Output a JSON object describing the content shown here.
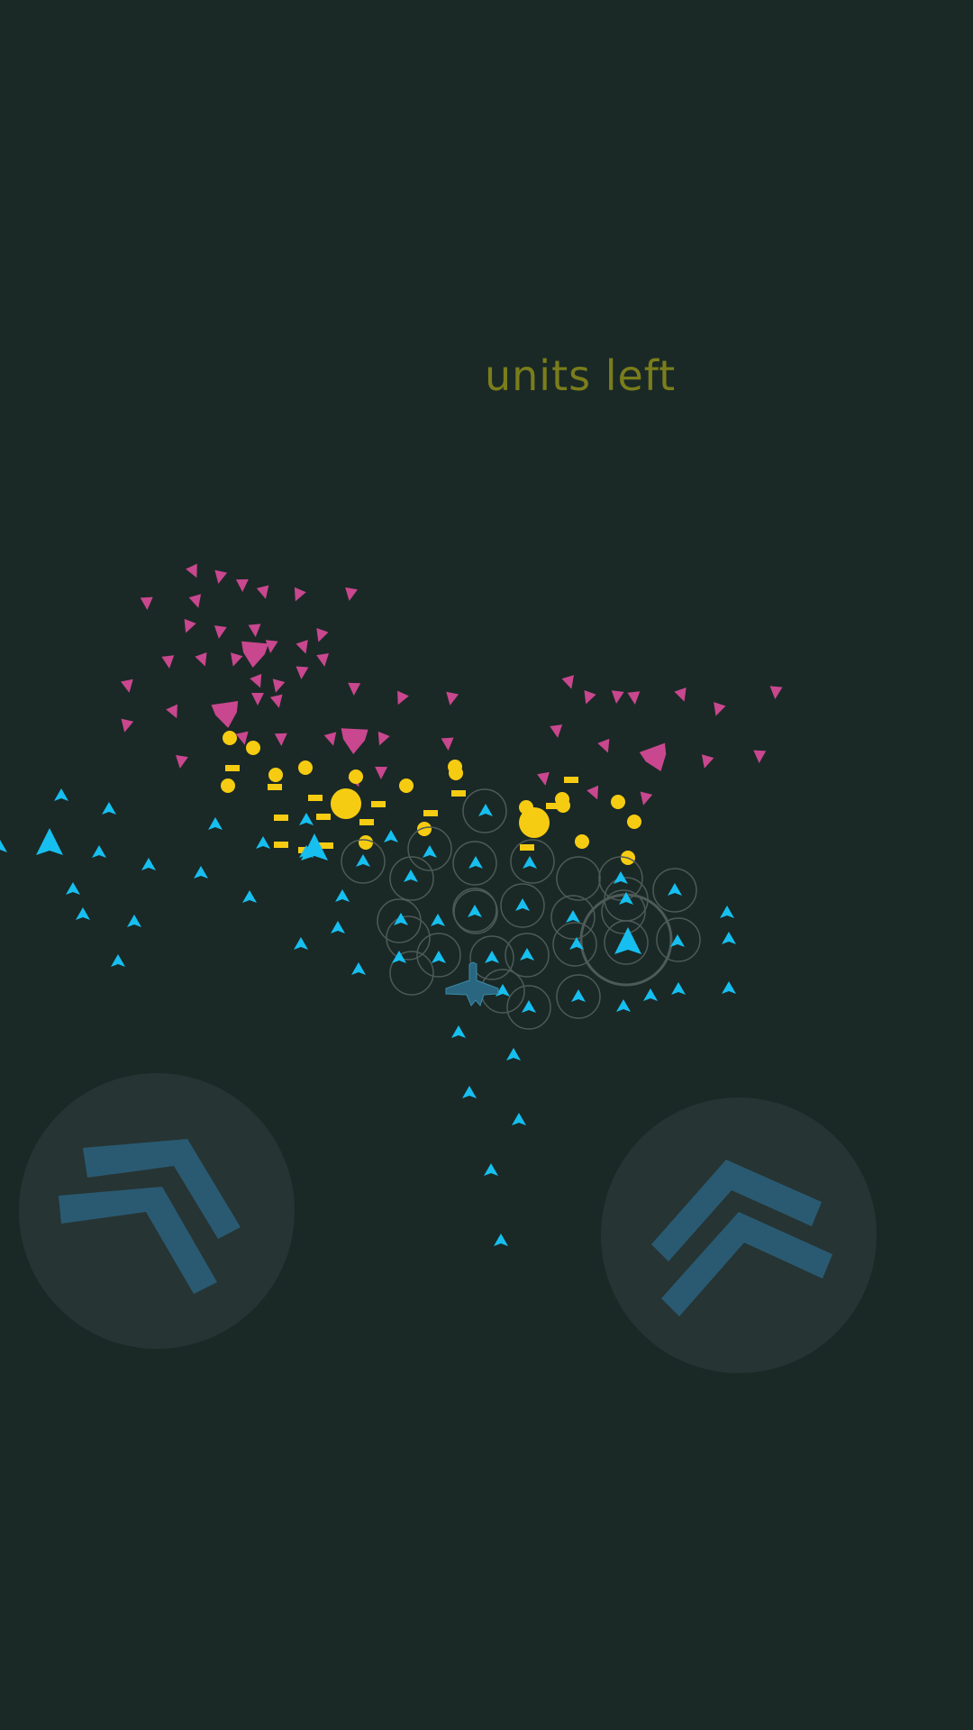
{
  "hud": {
    "status_text": "units left"
  },
  "colors": {
    "background": "#1a2926",
    "enemy": "#c9478e",
    "friendly": "#16bff0",
    "gold": "#f6cc12",
    "status_text": "#7a7d1b",
    "control_pad": "#263433",
    "control_arrow": "#2a5a72",
    "player_ship": "#2a6680",
    "ring": "#4e5a58"
  },
  "controls": {
    "left": {
      "name": "steer-left",
      "icon": "double-chevron-up-left-icon"
    },
    "right": {
      "name": "steer-right",
      "icon": "double-chevron-up-right-icon"
    }
  }
}
